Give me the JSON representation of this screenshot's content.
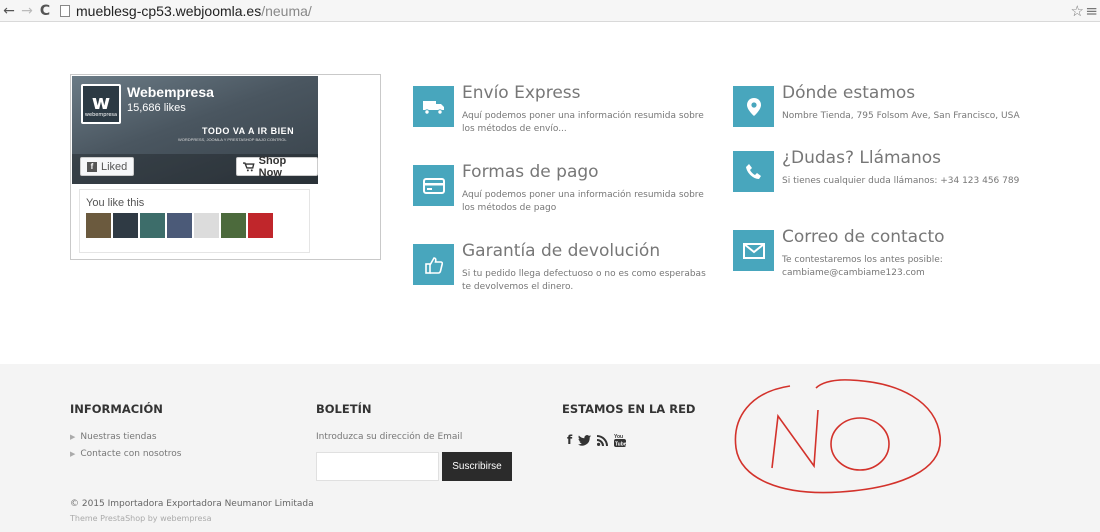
{
  "browser": {
    "back": "←",
    "forward": "→",
    "reload": "C",
    "url_host": "mueblesg-cp53.webjoomla.es",
    "url_path": "/neuma/",
    "star": "☆",
    "menu": "≡"
  },
  "facebook": {
    "page_name": "Webempresa",
    "likes": "15,686 likes",
    "logo_text": "w",
    "logo_sub": "webempresa",
    "slogan": "TODO VA A IR BIEN",
    "slogan_sub": "WORDPRESS, JOOMLA Y PRESTASHOP BAJO CONTROL",
    "liked_label": "Liked",
    "shop_label": "Shop Now",
    "you_like": "You like this",
    "avatar_colors": [
      "#6b5a3e",
      "#2f3a44",
      "#3d6d6a",
      "#4b5a78",
      "#dcdcdc",
      "#4c6a3c",
      "#c0262b"
    ]
  },
  "features": [
    {
      "icon": "truck-icon",
      "title": "Envío Express",
      "text": "Aquí podemos poner una información resumida sobre los métodos de envío..."
    },
    {
      "icon": "credit-card-icon",
      "title": "Formas de pago",
      "text": "Aquí podemos poner una información resumida sobre los métodos de pago"
    },
    {
      "icon": "thumbs-up-icon",
      "title": "Garantía de devolución",
      "text": "Si tu pedido llega defectuoso o no es como esperabas te devolvemos el dinero."
    },
    {
      "icon": "map-marker-icon",
      "title": "Dónde estamos",
      "text": "Nombre Tienda, 795 Folsom Ave, San Francisco, USA"
    },
    {
      "icon": "phone-icon",
      "title": "¿Dudas? Llámanos",
      "text": "Si tienes cualquier duda llámanos: +34 123 456 789"
    },
    {
      "icon": "envelope-icon",
      "title": "Correo de contacto",
      "text": "Te contestaremos los antes posible: cambiame@cambiame123.com"
    }
  ],
  "accent_color": "#48a6bd",
  "footer": {
    "info_heading": "INFORMACIÓN",
    "info_links": [
      "Nuestras tiendas",
      "Contacte con nosotros"
    ],
    "newsletter_heading": "BOLETÍN",
    "newsletter_text": "Introduzca su dirección de Email",
    "subscribe_label": "Suscribirse",
    "social_heading": "ESTAMOS EN LA RED",
    "social_icons": [
      "facebook-icon",
      "twitter-icon",
      "rss-icon",
      "youtube-icon"
    ],
    "copyright": "© 2015 Importadora Exportadora Neumanor Limitada",
    "theme": "Theme PrestaShop by webempresa"
  },
  "annotation": {
    "handwritten_text": "NO",
    "color": "#d3322b"
  }
}
